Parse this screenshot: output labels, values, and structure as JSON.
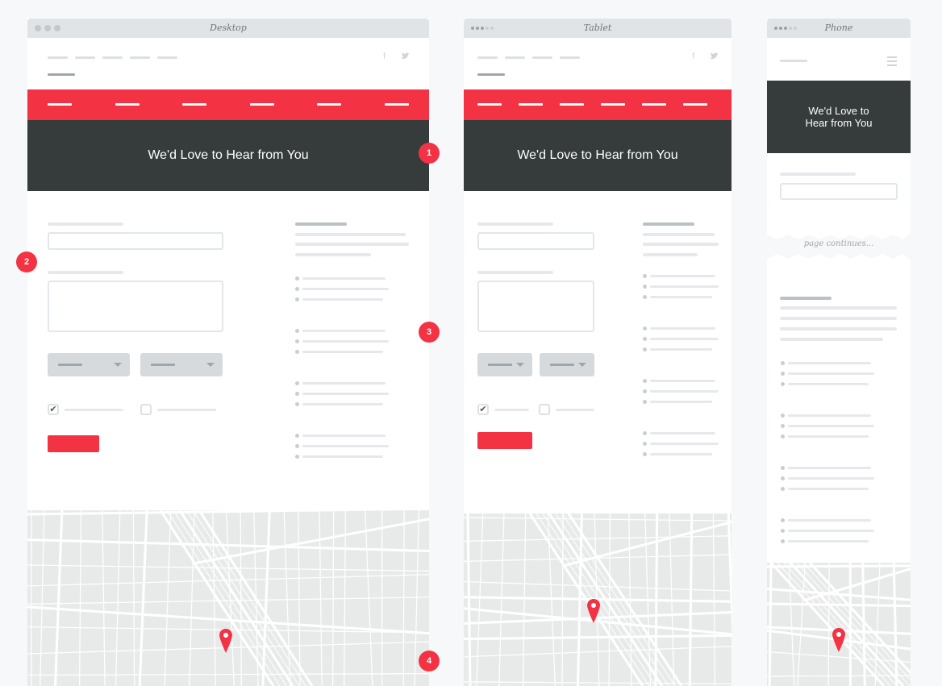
{
  "frames": {
    "desktop": {
      "title": "Desktop",
      "hero_title": "We'd Love to Hear from You"
    },
    "tablet": {
      "title": "Tablet",
      "hero_title": "We'd Love to Hear from You"
    },
    "phone": {
      "title": "Phone",
      "hero_title_line1": "We'd Love to",
      "hero_title_line2": "Hear from You",
      "continues": "page continues..."
    }
  },
  "social": {
    "facebook": "f",
    "twitter": "❧"
  },
  "checkboxes": {
    "first_checked": true,
    "second_checked": false,
    "check_glyph": "✔"
  },
  "annotations": [
    "1",
    "2",
    "3",
    "4"
  ],
  "colors": {
    "accent": "#f33343",
    "hero": "#363b3c",
    "map": "#e8eaea"
  }
}
